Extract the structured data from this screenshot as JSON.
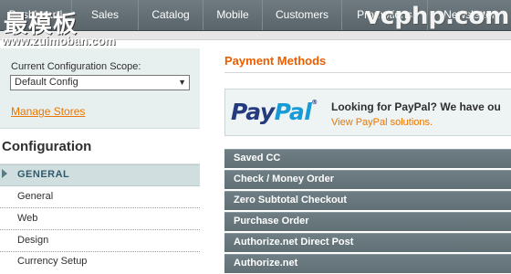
{
  "nav": {
    "items": [
      "Dashboard",
      "Sales",
      "Catalog",
      "Mobile",
      "Customers",
      "Promotions",
      "Newsletter"
    ]
  },
  "watermark": {
    "brand_cn": "最模板",
    "url": "www.zuimoban.com",
    "right_brand": "vcphp.com"
  },
  "sidebar": {
    "scope_label": "Current Configuration Scope:",
    "scope_value": "Default Config",
    "manage_stores": "Manage Stores",
    "config_title": "Configuration",
    "group_general": "GENERAL",
    "items": [
      "General",
      "Web",
      "Design",
      "Currency Setup"
    ]
  },
  "main": {
    "page_title": "Payment Methods",
    "paypal": {
      "logo_pay": "Pay",
      "logo_pal": "Pal",
      "logo_tm": "®",
      "heading": "Looking for PayPal? We have ou",
      "link": "View PayPal solutions."
    },
    "sections": [
      "Saved CC",
      "Check / Money Order",
      "Zero Subtotal Checkout",
      "Purchase Order",
      "Authorize.net Direct Post",
      "Authorize.net"
    ]
  },
  "colors": {
    "accent_orange": "#eb5e00",
    "nav_bg": "#616d72",
    "section_bg": "#687a80",
    "paypal_blue": "#253b80",
    "paypal_light_blue": "#179bd7"
  },
  "icons": {
    "scope_select_arrow": "chevron-down-icon",
    "group_expand": "triangle-right-icon"
  }
}
